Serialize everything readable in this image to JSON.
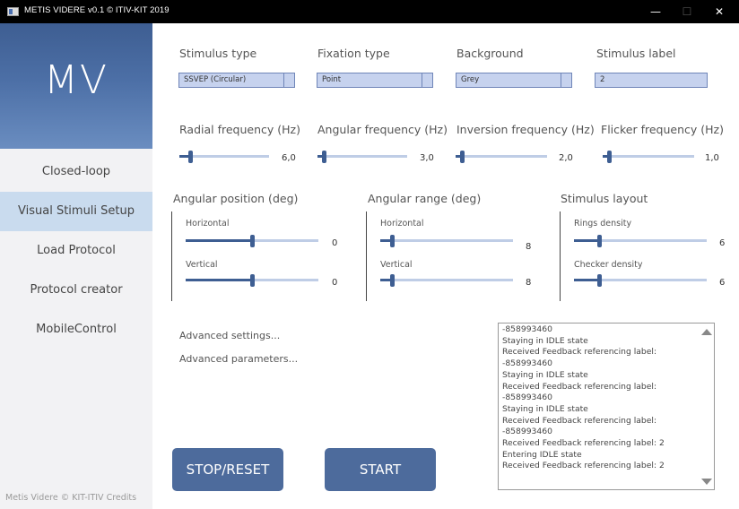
{
  "window": {
    "title": "METIS VIDERE v0.1 © ITIV-KIT 2019",
    "controls": {
      "minimize": "—",
      "maximize": "☐",
      "close": "✕"
    }
  },
  "sidebar": {
    "logo": "MV",
    "items": [
      {
        "label": "Closed-loop",
        "active": false
      },
      {
        "label": "Visual Stimuli Setup",
        "active": true
      },
      {
        "label": "Load Protocol",
        "active": false
      },
      {
        "label": "Protocol creator",
        "active": false
      },
      {
        "label": "MobileControl",
        "active": false
      }
    ],
    "credits": "Metis Videre © KIT-ITIV Credits"
  },
  "stimulus": {
    "type_label": "Stimulus type",
    "type_value": "SSVEP (Circular)",
    "fixation_label": "Fixation type",
    "fixation_value": "Point",
    "background_label": "Background",
    "background_value": "Grey",
    "label_label": "Stimulus label",
    "label_value": "2"
  },
  "frequencies": [
    {
      "label": "Radial frequency (Hz)",
      "value": "6,0",
      "fraction": 0.1
    },
    {
      "label": "Angular frequency (Hz)",
      "value": "3,0",
      "fraction": 0.05
    },
    {
      "label": "Inversion frequency (Hz)",
      "value": "2,0",
      "fraction": 0.05
    },
    {
      "label": "Flicker frequency (Hz)",
      "value": "1,0",
      "fraction": 0.05
    }
  ],
  "groups": {
    "angular_position": {
      "title": "Angular position (deg)",
      "horizontal_label": "Horizontal",
      "horizontal_value": "0",
      "horizontal_fraction": 0.5,
      "vertical_label": "Vertical",
      "vertical_value": "0",
      "vertical_fraction": 0.5
    },
    "angular_range": {
      "title": "Angular range (deg)",
      "horizontal_label": "Horizontal",
      "horizontal_value": "8",
      "horizontal_fraction": 0.08,
      "vertical_label": "Vertical",
      "vertical_value": "8",
      "vertical_fraction": 0.08
    },
    "layout": {
      "title": "Stimulus layout",
      "rings_label": "Rings density",
      "rings_value": "6",
      "rings_fraction": 0.18,
      "checker_label": "Checker density",
      "checker_value": "6",
      "checker_fraction": 0.18
    }
  },
  "links": {
    "advanced_settings": "Advanced settings...",
    "advanced_parameters": "Advanced parameters..."
  },
  "buttons": {
    "stop": "STOP/RESET",
    "start": "START"
  },
  "log": {
    "lines": [
      "-858993460",
      "Staying in IDLE state",
      "Received Feedback referencing label:",
      "-858993460",
      "Staying in IDLE state",
      "Received Feedback referencing label:",
      "-858993460",
      "Staying in IDLE state",
      "Received Feedback referencing label:",
      "-858993460",
      "Received Feedback referencing label: 2",
      "Entering IDLE state",
      "Received Feedback referencing label: 2"
    ]
  },
  "colors": {
    "accent": "#3e5e92",
    "active_nav": "#c9dbee",
    "button": "#4d6b9c",
    "field": "#c6d2ee"
  }
}
